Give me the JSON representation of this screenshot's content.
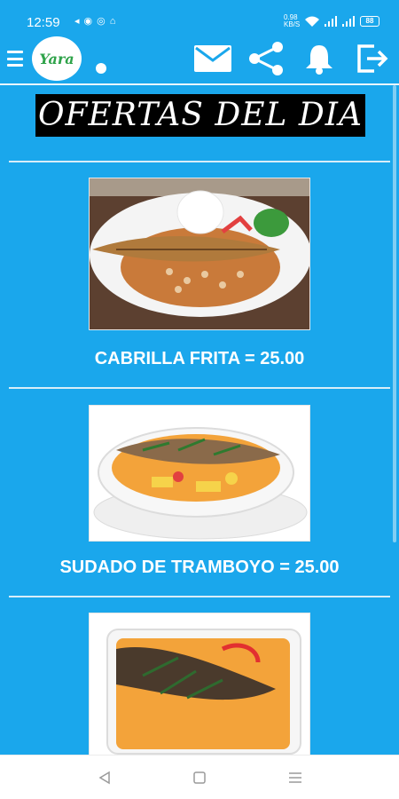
{
  "status_bar": {
    "time": "12:59",
    "left_icons": [
      "notification-icon",
      "circle-icon",
      "instagram-icon",
      "messenger-icon"
    ],
    "right_icons": [
      "data-speed-icon",
      "wifi-icon",
      "signal-icon",
      "signal-icon"
    ],
    "data_speed": "0.98 KB/S",
    "battery": "88"
  },
  "app_bar": {
    "menu_icon": "menu-icon",
    "logo_text": "Yara",
    "actions": [
      "mail-icon",
      "share-icon",
      "bell-icon",
      "logout-icon"
    ]
  },
  "page": {
    "title": "OFERTAS DEL DIA"
  },
  "offers": [
    {
      "caption": "CABRILLA FRITA = 25.00"
    },
    {
      "caption": "SUDADO DE TRAMBOYO = 25.00"
    },
    {
      "caption": ""
    }
  ],
  "nav_bar": {
    "buttons": [
      "back-icon",
      "home-icon",
      "recents-icon"
    ]
  },
  "colors": {
    "background": "#1aa7ec",
    "title_bg": "#000000",
    "text": "#ffffff"
  }
}
